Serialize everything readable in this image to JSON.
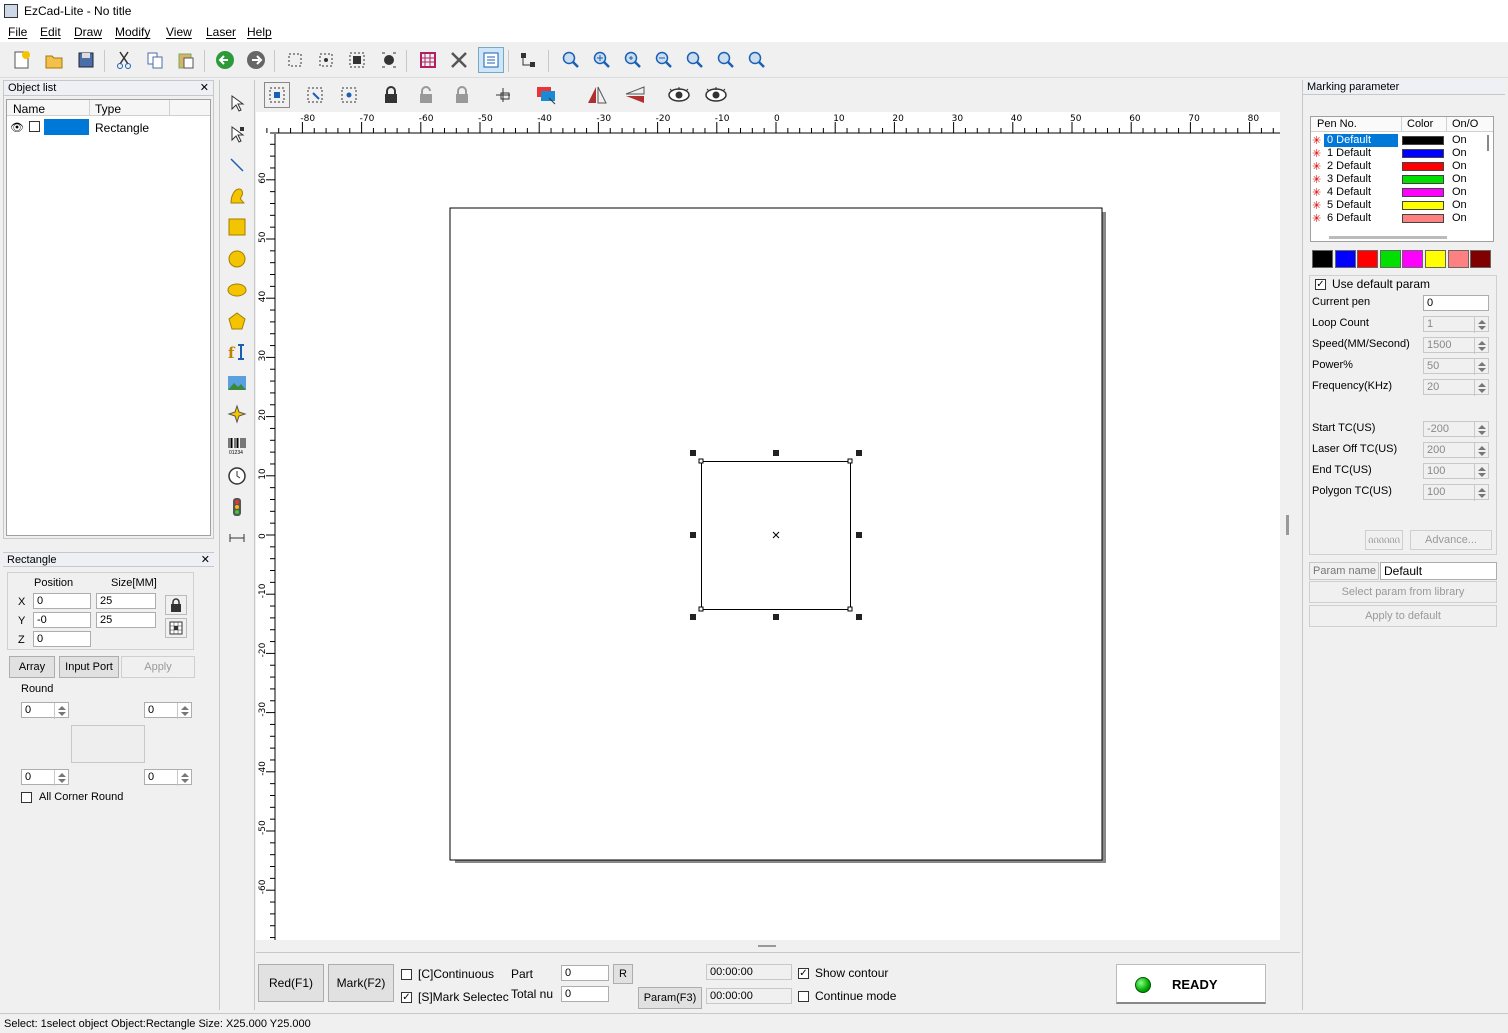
{
  "window": {
    "title": "EzCad-Lite - No title"
  },
  "menu": [
    "File",
    "Edit",
    "Draw",
    "Modify",
    "View",
    "Laser",
    "Help"
  ],
  "object_list": {
    "title": "Object list",
    "col_name": "Name",
    "col_type": "Type",
    "rows": [
      {
        "name": "",
        "type": "Rectangle"
      }
    ]
  },
  "prop_panel": {
    "title": "Rectangle",
    "position_label": "Position",
    "size_label": "Size[MM]",
    "x_label": "X",
    "y_label": "Y",
    "z_label": "Z",
    "x_pos": "0",
    "y_pos": "-0",
    "z_pos": "0",
    "x_size": "25",
    "y_size": "25",
    "array_label": "Array",
    "input_port_label": "Input Port",
    "apply_label": "Apply",
    "round_label": "Round",
    "round_tl": "0",
    "round_tr": "0",
    "round_bl": "0",
    "round_br": "0",
    "all_corner_round_label": "All Corner Round"
  },
  "ruler": {
    "h_ticks": [
      "-80",
      "-70",
      "-60",
      "-50",
      "-40",
      "-30",
      "-20",
      "-10",
      "0",
      "10",
      "20",
      "30",
      "40",
      "50",
      "60",
      "70",
      "80"
    ],
    "v_ticks": [
      "60",
      "50",
      "40",
      "30",
      "20",
      "10",
      "0",
      "-10",
      "-20",
      "-30",
      "-40",
      "-50",
      "-60"
    ]
  },
  "bottom_bar": {
    "red_label": "Red(F1)",
    "mark_label": "Mark(F2)",
    "continuous_label": "[C]Continuous",
    "mark_selected_label": "[S]Mark Selectec",
    "part_label": "Part",
    "part_value": "0",
    "r_label": "R",
    "total_label": "Total nu",
    "total_value": "0",
    "time1": "00:00:00",
    "time2": "00:00:00",
    "param_label": "Param(F3)",
    "show_contour_label": "Show contour",
    "continue_mode_label": "Continue mode",
    "status_label": "READY"
  },
  "marking": {
    "title": "Marking parameter",
    "col_pen": "Pen No.",
    "col_color": "Color",
    "col_onoff": "On/O",
    "pens": [
      {
        "no": "0",
        "name": "Default",
        "color": "#000000",
        "state": "On"
      },
      {
        "no": "1",
        "name": "Default",
        "color": "#0000ff",
        "state": "On"
      },
      {
        "no": "2",
        "name": "Default",
        "color": "#ff0000",
        "state": "On"
      },
      {
        "no": "3",
        "name": "Default",
        "color": "#00e000",
        "state": "On"
      },
      {
        "no": "4",
        "name": "Default",
        "color": "#ff00ff",
        "state": "On"
      },
      {
        "no": "5",
        "name": "Default",
        "color": "#ffff00",
        "state": "On"
      },
      {
        "no": "6",
        "name": "Default",
        "color": "#ff8080",
        "state": "On"
      }
    ],
    "palette": [
      "#000000",
      "#0000ff",
      "#ff0000",
      "#00e000",
      "#ff00ff",
      "#ffff00",
      "#ff8080",
      "#800000"
    ],
    "use_default_label": "Use default param",
    "current_pen_label": "Current pen",
    "current_pen": "0",
    "loop_count_label": "Loop Count",
    "loop_count": "1",
    "speed_label": "Speed(MM/Second)",
    "speed": "1500",
    "power_label": "Power%",
    "power": "50",
    "freq_label": "Frequency(KHz)",
    "freq": "20",
    "start_tc_label": "Start TC(US)",
    "start_tc": "-200",
    "laser_off_tc_label": "Laser Off TC(US)",
    "laser_off_tc": "200",
    "end_tc_label": "End TC(US)",
    "end_tc": "100",
    "polygon_tc_label": "Polygon TC(US)",
    "polygon_tc": "100",
    "advance_label": "Advance...",
    "param_name_label": "Param name",
    "param_name": "Default",
    "select_lib_label": "Select param from library",
    "apply_default_label": "Apply to default"
  },
  "statusbar": {
    "text": "Select: 1select object Object:Rectangle Size: X25.000 Y25.000"
  }
}
